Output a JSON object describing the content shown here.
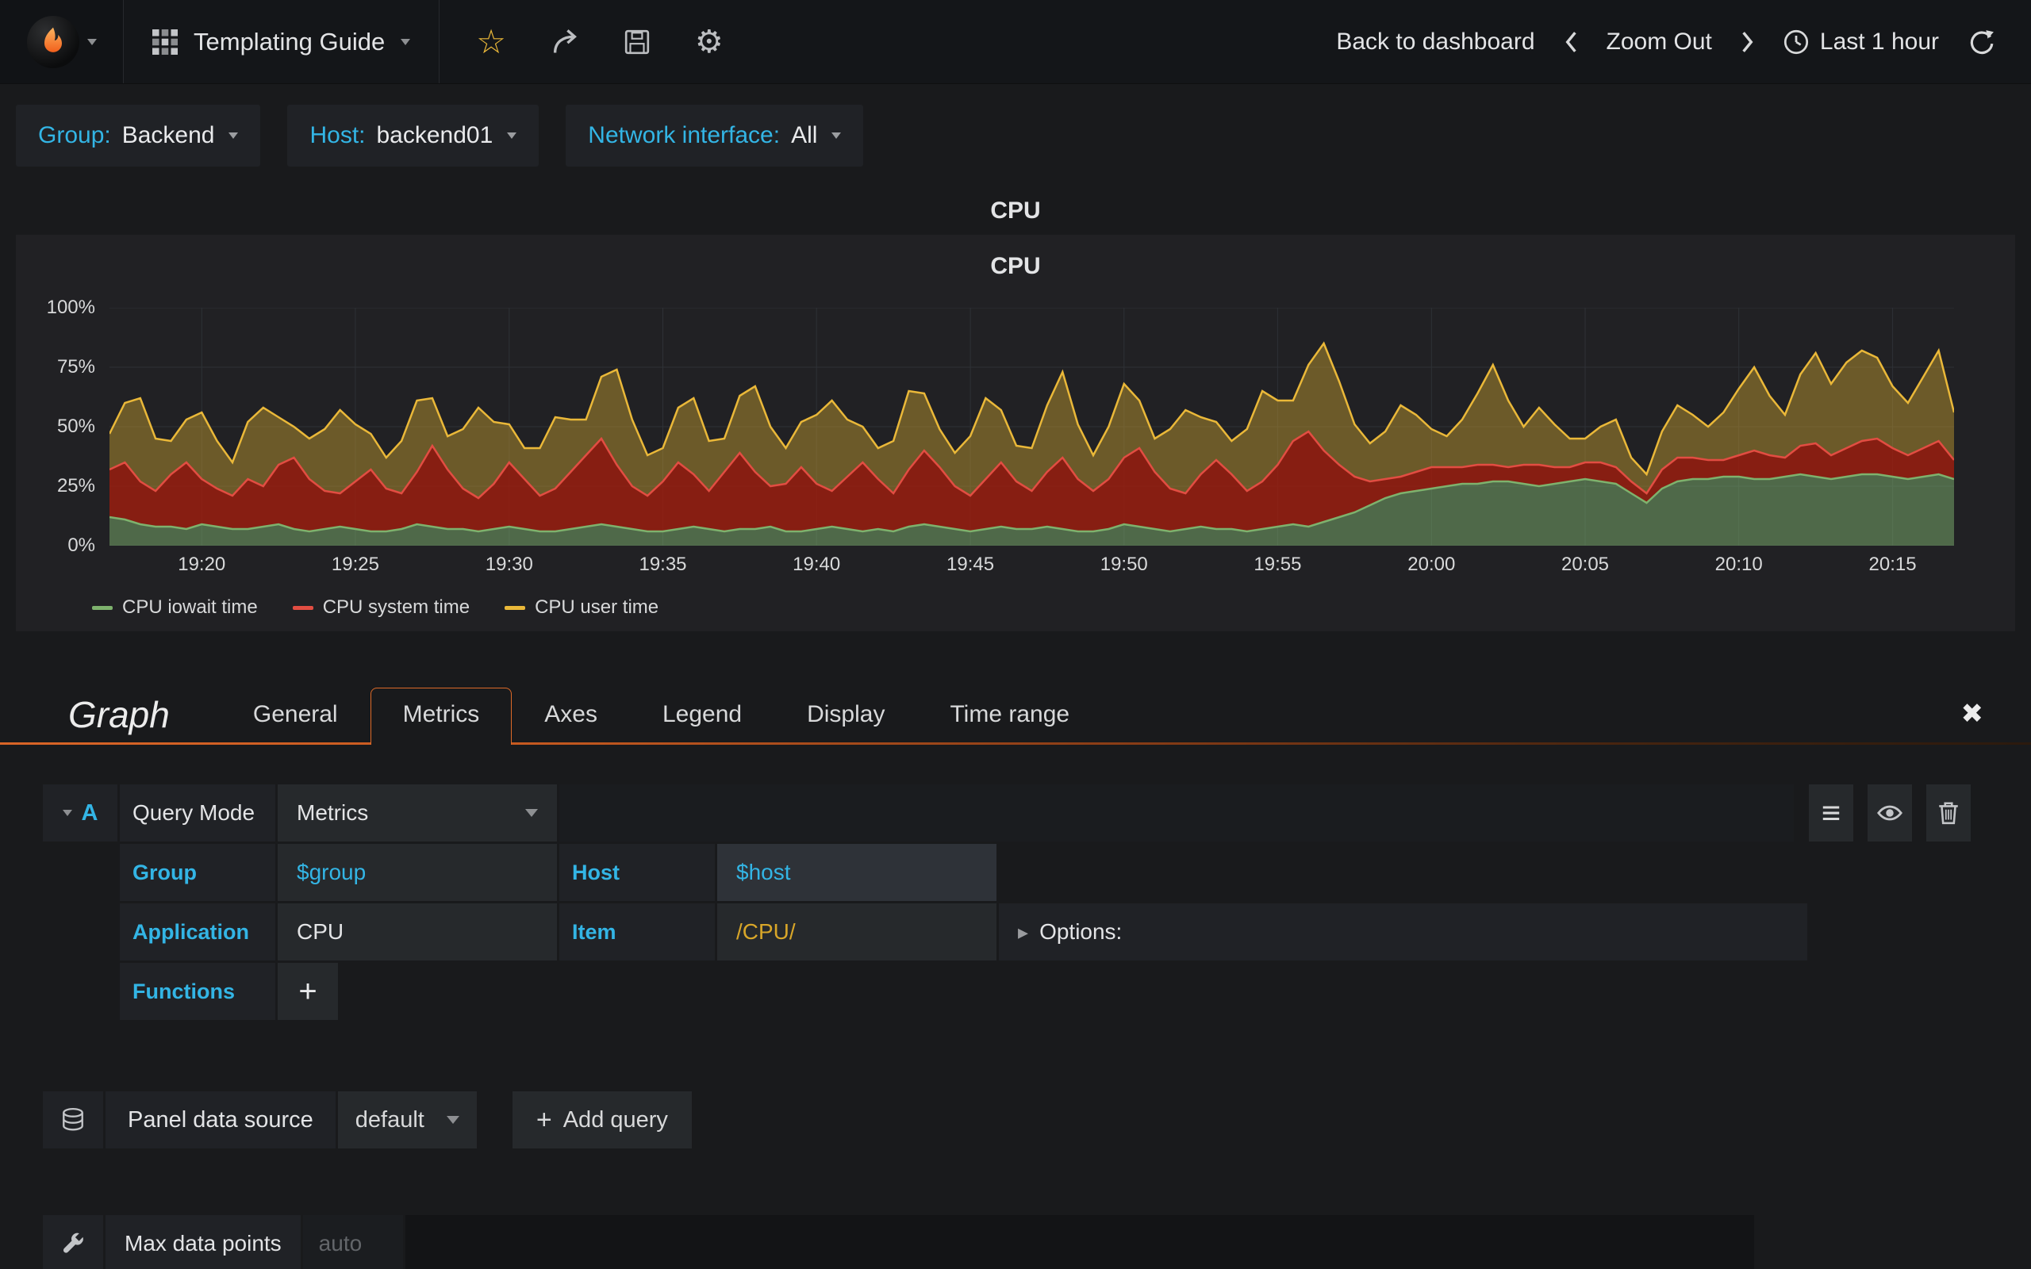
{
  "navbar": {
    "dashboard_title": "Templating Guide",
    "back_to_dashboard": "Back to dashboard",
    "zoom_out": "Zoom Out",
    "time_range": "Last 1 hour"
  },
  "icons": {
    "star": "☆",
    "settings": "⚙",
    "close": "✖",
    "hamburger": "≡",
    "options_caret": "▸",
    "plus": "+"
  },
  "variables": [
    {
      "label": "Group:",
      "value": "Backend"
    },
    {
      "label": "Host:",
      "value": "backend01"
    },
    {
      "label": "Network interface:",
      "value": "All"
    }
  ],
  "panel": {
    "title": "CPU"
  },
  "chart_data": {
    "type": "area",
    "stacked": true,
    "title": "CPU",
    "ylim": [
      0,
      100
    ],
    "ytick_labels": [
      "100%",
      "75%",
      "50%",
      "25%",
      "0%"
    ],
    "xtick_labels": [
      "19:20",
      "19:25",
      "19:30",
      "19:35",
      "19:40",
      "19:45",
      "19:50",
      "19:55",
      "20:00",
      "20:05",
      "20:10",
      "20:15"
    ],
    "xtick_fracs": [
      0.05,
      0.1333,
      0.2167,
      0.3,
      0.3833,
      0.4667,
      0.55,
      0.6333,
      0.7167,
      0.8,
      0.8833,
      0.9667
    ],
    "grid": true,
    "legend_position": "bottom-left",
    "series": [
      {
        "name": "CPU iowait time",
        "color": "#7EB26D",
        "fill": "rgba(126,178,109,0.5)",
        "values": [
          12,
          11,
          9,
          8,
          8,
          7,
          9,
          8,
          7,
          7,
          8,
          9,
          7,
          6,
          7,
          8,
          7,
          6,
          6,
          7,
          9,
          8,
          7,
          7,
          6,
          7,
          8,
          7,
          6,
          6,
          7,
          8,
          9,
          8,
          7,
          6,
          6,
          7,
          8,
          7,
          6,
          7,
          7,
          8,
          6,
          6,
          7,
          8,
          7,
          6,
          7,
          6,
          8,
          9,
          8,
          7,
          6,
          7,
          8,
          7,
          7,
          8,
          7,
          6,
          6,
          7,
          9,
          8,
          7,
          6,
          7,
          8,
          7,
          7,
          6,
          7,
          8,
          9,
          8,
          10,
          12,
          14,
          17,
          20,
          22,
          23,
          24,
          25,
          26,
          26,
          27,
          27,
          26,
          25,
          26,
          27,
          28,
          27,
          26,
          22,
          18,
          24,
          27,
          28,
          28,
          29,
          29,
          28,
          28,
          29,
          30,
          29,
          28,
          29,
          30,
          30,
          29,
          28,
          29,
          30,
          28
        ]
      },
      {
        "name": "CPU system time",
        "color": "#E24D42",
        "fill": "rgba(170,30,12,0.75)",
        "values": [
          20,
          24,
          18,
          15,
          22,
          28,
          19,
          16,
          14,
          21,
          17,
          25,
          30,
          22,
          16,
          14,
          20,
          26,
          18,
          15,
          22,
          34,
          25,
          17,
          14,
          19,
          27,
          21,
          15,
          18,
          24,
          30,
          36,
          26,
          18,
          15,
          21,
          28,
          22,
          16,
          25,
          32,
          24,
          17,
          20,
          27,
          19,
          15,
          22,
          29,
          21,
          16,
          24,
          31,
          25,
          18,
          15,
          21,
          27,
          20,
          16,
          23,
          30,
          22,
          17,
          21,
          28,
          33,
          24,
          18,
          15,
          22,
          29,
          23,
          17,
          20,
          26,
          35,
          40,
          30,
          22,
          15,
          10,
          8,
          7,
          8,
          9,
          8,
          7,
          8,
          7,
          6,
          8,
          9,
          7,
          6,
          7,
          8,
          7,
          5,
          4,
          8,
          10,
          9,
          8,
          7,
          9,
          12,
          10,
          8,
          12,
          14,
          10,
          12,
          14,
          15,
          12,
          10,
          12,
          14,
          8
        ]
      },
      {
        "name": "CPU user time",
        "color": "#EAB839",
        "fill": "rgba(200,160,48,0.45)",
        "values": [
          15,
          25,
          35,
          22,
          14,
          18,
          28,
          20,
          14,
          24,
          33,
          20,
          13,
          17,
          26,
          35,
          24,
          15,
          13,
          22,
          30,
          20,
          14,
          25,
          38,
          26,
          16,
          13,
          20,
          30,
          22,
          15,
          26,
          40,
          28,
          17,
          14,
          23,
          32,
          21,
          14,
          24,
          36,
          25,
          15,
          19,
          29,
          38,
          24,
          15,
          13,
          22,
          33,
          24,
          16,
          14,
          25,
          34,
          22,
          15,
          18,
          28,
          36,
          23,
          15,
          22,
          31,
          20,
          14,
          25,
          35,
          24,
          16,
          14,
          26,
          38,
          27,
          17,
          28,
          45,
          35,
          22,
          16,
          20,
          30,
          24,
          16,
          13,
          20,
          30,
          42,
          28,
          16,
          24,
          18,
          12,
          10,
          15,
          20,
          10,
          8,
          16,
          22,
          18,
          14,
          20,
          28,
          35,
          25,
          18,
          30,
          38,
          30,
          36,
          38,
          34,
          26,
          22,
          30,
          38,
          20
        ]
      }
    ]
  },
  "editor": {
    "panel_type": "Graph",
    "tabs": [
      "General",
      "Metrics",
      "Axes",
      "Legend",
      "Display",
      "Time range"
    ],
    "active_tab": "Metrics",
    "query": {
      "ref_id": "A",
      "mode_label": "Query Mode",
      "mode_value": "Metrics",
      "group_label": "Group",
      "group_value": "$group",
      "host_label": "Host",
      "host_value": "$host",
      "application_label": "Application",
      "application_value": "CPU",
      "item_label": "Item",
      "item_value": "/CPU/",
      "options_label": "Options:",
      "functions_label": "Functions"
    },
    "datasource": {
      "label": "Panel data source",
      "value": "default",
      "add_query": "Add query"
    },
    "max_data_points": {
      "label": "Max data points",
      "placeholder": "auto"
    }
  },
  "colors": {
    "accent_blue": "#33b5e5",
    "accent_orange": "#dd6a28",
    "yellow_text": "#d8a629"
  }
}
